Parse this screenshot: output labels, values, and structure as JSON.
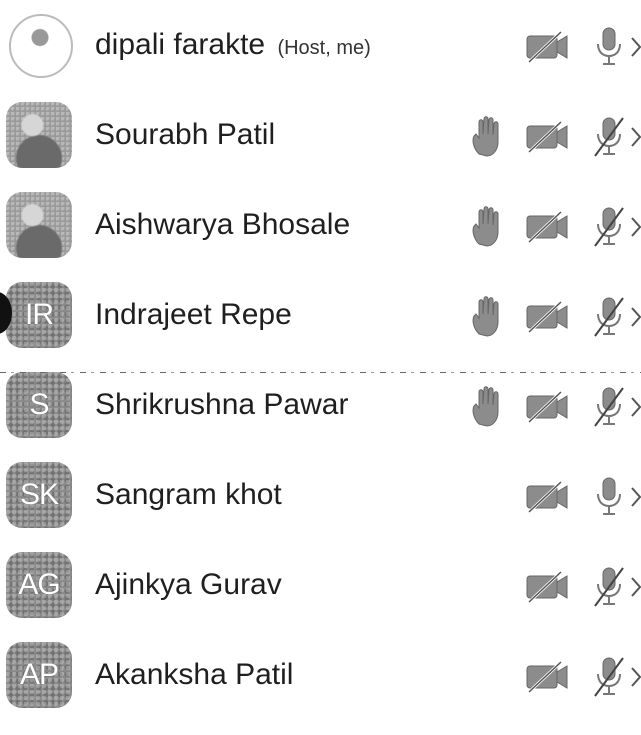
{
  "participants": [
    {
      "name": "dipali farakte",
      "tag": "(Host, me)",
      "avatar": {
        "type": "outline",
        "initials": ""
      },
      "hand_raised": false,
      "video_icon": "video-off-icon",
      "mic_icon": "mic-on-icon",
      "mic_muted": false
    },
    {
      "name": "Sourabh Patil",
      "tag": "",
      "avatar": {
        "type": "photo",
        "initials": ""
      },
      "hand_raised": true,
      "video_icon": "video-off-icon",
      "mic_icon": "mic-off-icon",
      "mic_muted": true
    },
    {
      "name": "Aishwarya Bhosale",
      "tag": "",
      "avatar": {
        "type": "photo",
        "initials": ""
      },
      "hand_raised": true,
      "video_icon": "video-off-icon",
      "mic_icon": "mic-off-icon",
      "mic_muted": true
    },
    {
      "name": "Indrajeet Repe",
      "tag": "",
      "avatar": {
        "type": "initials",
        "initials": "IR"
      },
      "hand_raised": true,
      "video_icon": "video-off-icon",
      "mic_icon": "mic-off-icon",
      "mic_muted": true
    },
    {
      "name": "Shrikrushna Pawar",
      "tag": "",
      "avatar": {
        "type": "initials",
        "initials": "S"
      },
      "hand_raised": true,
      "video_icon": "video-off-icon",
      "mic_icon": "mic-off-icon",
      "mic_muted": true
    },
    {
      "name": "Sangram khot",
      "tag": "",
      "avatar": {
        "type": "initials",
        "initials": "SK"
      },
      "hand_raised": false,
      "video_icon": "video-off-icon",
      "mic_icon": "mic-on-icon",
      "mic_muted": false
    },
    {
      "name": "Ajinkya Gurav",
      "tag": "",
      "avatar": {
        "type": "initials",
        "initials": "AG"
      },
      "hand_raised": false,
      "video_icon": "video-off-icon",
      "mic_icon": "mic-off-icon",
      "mic_muted": true
    },
    {
      "name": "Akanksha Patil",
      "tag": "",
      "avatar": {
        "type": "initials",
        "initials": "AP"
      },
      "hand_raised": false,
      "video_icon": "video-off-icon",
      "mic_icon": "mic-off-icon",
      "mic_muted": true
    }
  ],
  "colors": {
    "icon_gray": "#8c8c8c",
    "text": "#1f1f1f",
    "avatar_bg": "#8a8a8a"
  }
}
